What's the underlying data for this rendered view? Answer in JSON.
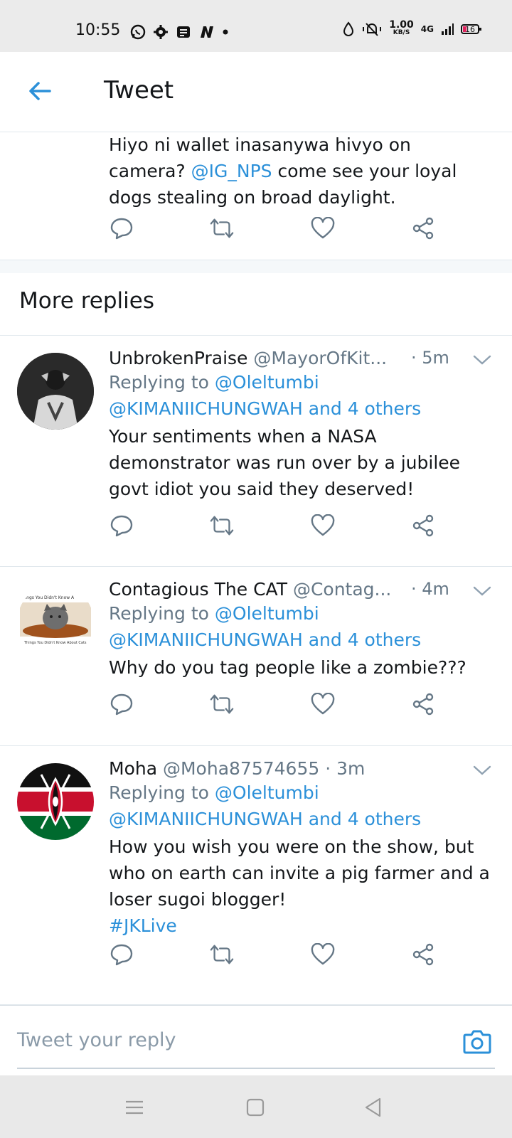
{
  "status_bar": {
    "time": "10:55",
    "speed_value": "1.00",
    "speed_unit": "KB/S",
    "network": "4G",
    "battery": "16"
  },
  "header": {
    "title": "Tweet"
  },
  "top_tweet": {
    "text_before": "Hiyo ni wallet inasanywa hivyo on camera? ",
    "mention": "@IG_NPS",
    "text_after": " come see your loyal dogs stealing on broad daylight."
  },
  "more_replies": {
    "heading": "More replies"
  },
  "replies": [
    {
      "name": "UnbrokenPraise",
      "handle": "@MayorOfKit...",
      "time": "· 5m",
      "replying_prefix": "Replying to ",
      "replying_user": "@Oleltumbi",
      "replying_line2": "@KIMANIICHUNGWAH and 4 others",
      "text": "Your sentiments when a NASA demonstrator was run over by a jubilee govt idiot you said they deserved!"
    },
    {
      "name": "Contagious The CAT",
      "handle": "@Contag...",
      "time": "· 4m",
      "avatar_caption_top": "Things You Didn't Know A",
      "avatar_caption_bottom": "Things You Didn't Know About Cats",
      "replying_prefix": "Replying to ",
      "replying_user": "@Oleltumbi",
      "replying_line2": "@KIMANIICHUNGWAH and 4 others",
      "text": "Why do you tag people like a zombie???"
    },
    {
      "name": "Moha",
      "handle": "@Moha87574655",
      "time": "· 3m",
      "replying_prefix": "Replying to ",
      "replying_user": "@Oleltumbi",
      "replying_line2": "@KIMANIICHUNGWAH and 4 others",
      "text": "How you wish you were on the show, but who on earth can invite a pig farmer and a loser sugoi blogger!",
      "hashtag": "#JKLive"
    }
  ],
  "composer": {
    "placeholder": "Tweet your reply"
  },
  "colors": {
    "accent": "#2b90d9",
    "muted": "#657786",
    "divider": "#e1e8ed"
  }
}
